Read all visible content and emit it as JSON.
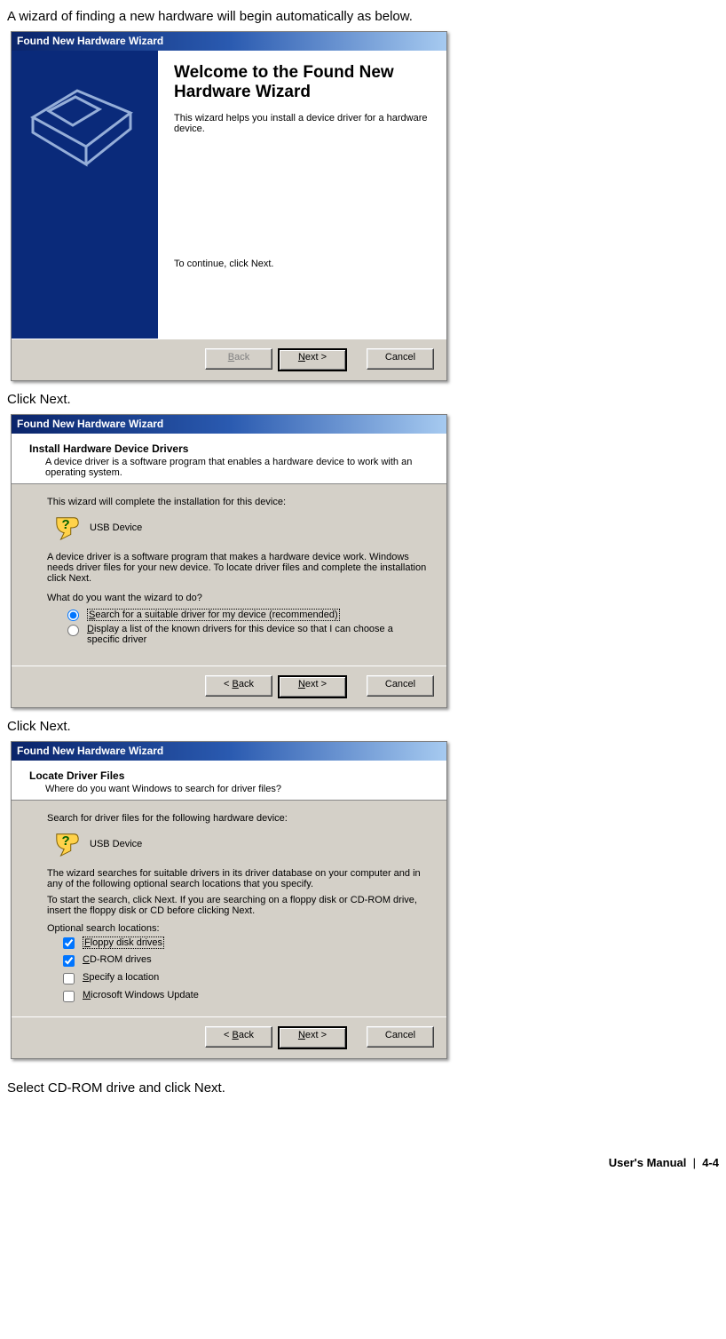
{
  "doc": {
    "intro": "A wizard of finding a new hardware will begin automatically as below.",
    "click_next_1": "Click Next.",
    "click_next_2": "Click Next.",
    "select_cd": "Select CD-ROM drive and click Next.",
    "footer": "User's Manual",
    "page": "4-4"
  },
  "wiz1": {
    "title": "Found New Hardware Wizard",
    "heading": "Welcome to the Found New Hardware Wizard",
    "desc": "This wizard helps you install a device driver for a hardware device.",
    "continue": "To continue, click Next.",
    "back": "< Back",
    "next": "Next >",
    "cancel": "Cancel"
  },
  "wiz2": {
    "title": "Found New Hardware Wizard",
    "h_title": "Install Hardware Device Drivers",
    "h_sub": "A device driver is a software program that enables a hardware device to work with an operating system.",
    "line1": "This wizard will complete the installation for this device:",
    "device": "USB Device",
    "desc2": "A device driver is a software program that makes a hardware device work. Windows needs driver files for your new device. To locate driver files and complete the installation click Next.",
    "question": "What do you want the wizard to do?",
    "opt1": "Search for a suitable driver for my device (recommended)",
    "opt2": "Display a list of the known drivers for this device so that I can choose a specific driver",
    "back": "< Back",
    "next": "Next >",
    "cancel": "Cancel"
  },
  "wiz3": {
    "title": "Found New Hardware Wizard",
    "h_title": "Locate Driver Files",
    "h_sub": "Where do you want Windows to search for driver files?",
    "line1": "Search for driver files for the following hardware device:",
    "device": "USB Device",
    "desc2": "The wizard searches for suitable drivers in its driver database on your computer and in any of the following optional search locations that you specify.",
    "desc3": "To start the search, click Next. If you are searching on a floppy disk or CD-ROM drive, insert the floppy disk or CD before clicking Next.",
    "opt_label": "Optional search locations:",
    "c1": "Floppy disk drives",
    "c2": "CD-ROM drives",
    "c3": "Specify a location",
    "c4": "Microsoft Windows Update",
    "back": "< Back",
    "next": "Next >",
    "cancel": "Cancel"
  }
}
